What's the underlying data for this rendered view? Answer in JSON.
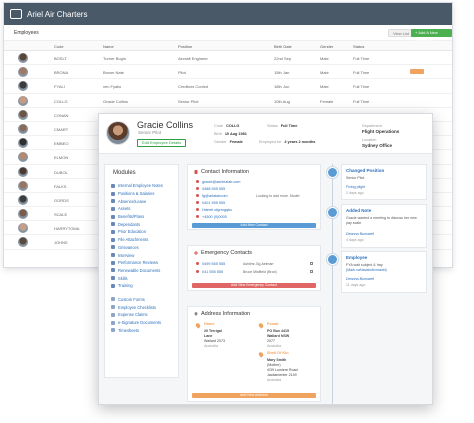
{
  "app": {
    "title": "Ariel Air Charters"
  },
  "employees": {
    "title": "Employees",
    "view_btn": "View List",
    "add_btn": "+ Add A New Employee",
    "columns": [
      "Code",
      "Name",
      "Position",
      "Birth Date",
      "Gender",
      "Status"
    ],
    "rows": [
      {
        "code": "BOSLT",
        "name": "Turner Bogin",
        "position": "Aircraft Engineer",
        "birth": "22nd Sep",
        "gender": "Male",
        "status": "Full Time",
        "badge": false
      },
      {
        "code": "BRONA",
        "name": "Brown Nate",
        "position": "Pilot",
        "birth": "15th Jan",
        "gender": "Male",
        "status": "Full Time",
        "badge": true
      },
      {
        "code": "FYALI",
        "name": "ven Fyalio",
        "position": "Creditors Control",
        "birth": "18th Jun",
        "gender": "Male",
        "status": "Full Time",
        "badge": false
      },
      {
        "code": "COLLG",
        "name": "Gracie Collins",
        "position": "Senior Pilot",
        "birth": "10th Aug",
        "gender": "Female",
        "status": "Full Time",
        "badge": false
      },
      {
        "code": "CONAN",
        "name": "",
        "position": "",
        "birth": "",
        "gender": "",
        "status": "",
        "badge": false
      },
      {
        "code": "CMART",
        "name": "",
        "position": "",
        "birth": "",
        "gender": "",
        "status": "",
        "badge": false
      },
      {
        "code": "EMBEO",
        "name": "",
        "position": "",
        "birth": "",
        "gender": "",
        "status": "",
        "badge": false
      },
      {
        "code": "ELMON",
        "name": "",
        "position": "",
        "birth": "",
        "gender": "",
        "status": "",
        "badge": false
      },
      {
        "code": "DUBOL",
        "name": "",
        "position": "",
        "birth": "",
        "gender": "",
        "status": "",
        "badge": false
      },
      {
        "code": "FALKS",
        "name": "",
        "position": "",
        "birth": "",
        "gender": "",
        "status": "",
        "badge": false
      },
      {
        "code": "GORDS",
        "name": "",
        "position": "",
        "birth": "",
        "gender": "",
        "status": "",
        "badge": false
      },
      {
        "code": "SCALE",
        "name": "",
        "position": "",
        "birth": "",
        "gender": "",
        "status": "",
        "badge": false
      },
      {
        "code": "HARRYTOMA",
        "name": "",
        "position": "",
        "birth": "",
        "gender": "",
        "status": "",
        "badge": false
      },
      {
        "code": "JOHNS",
        "name": "",
        "position": "",
        "birth": "",
        "gender": "",
        "status": "",
        "badge": false
      }
    ]
  },
  "profile": {
    "name": "Gracie Collins",
    "role": "Senior Pilot",
    "edit_btn": "Edit Employee Details",
    "code_label": "Code",
    "code": "COLLG",
    "status_label": "Status",
    "status": "Full Time",
    "birth_label": "Birth",
    "birth": "10 Aug 1981",
    "gender_label": "Gender",
    "gender": "Female",
    "employed_label": "Employed for",
    "employed": "4 years 2 months",
    "dept_label": "Department",
    "dept": "Flight Operations",
    "location_label": "Location",
    "location": "Sydney Office"
  },
  "modules": {
    "title": "Modules",
    "items": [
      "Internal Employee Notes",
      "Positions & Salaries",
      "Absence/Leave",
      "Assets",
      "Benefits/Plans",
      "Dependants",
      "Prior Education",
      "File Attachments",
      "Grievances",
      "Interview",
      "Performance Reviews",
      "Renewable Documents",
      "Skills",
      "Training"
    ],
    "others": [
      "Custom Forms",
      "Employee Checklists",
      "Expense Claims",
      "e-Signature Documents",
      "Timesheets"
    ]
  },
  "contact": {
    "title": "Contact Information",
    "email": "gracie@ashirialair.com",
    "phone1": "0488 555 555",
    "phone1_note": "",
    "work_email": "fg@arialaircom",
    "work_note": "Looking to add more. Model",
    "phone2": "0401 555 555",
    "phone2_note": "",
    "address_line": "Hdemt ofgrmgqbc",
    "extra": "+4500 (0)0000",
    "add_btn": "Add New Contact"
  },
  "emergency": {
    "title": "Emergency Contacts",
    "row1_phone": "0499 555 555",
    "row1_note": "Ashilmr-Gg.Aelmarr",
    "row2_phone": "041 555 555",
    "row2_note": "Bruce Miidfield (Brod)",
    "add_btn": "Add New Emergency Contact"
  },
  "address": {
    "title": "Address Information",
    "home_tag": "Home",
    "home_lines": [
      "20 Terrigal",
      "Lane",
      "Wallard 2073",
      "Australia"
    ],
    "postal_tag": "Postal",
    "postal_lines": [
      "PO Box 4415",
      "Wallard NSW",
      "2077",
      "Australia"
    ],
    "other_tag": "Shell Of Kin",
    "other_lines": [
      "Mary Smith",
      "(Mother)",
      "4/39 Lumiere Road",
      "Jackamenter 2149",
      "Australia"
    ],
    "add_btn": "Add New Address"
  },
  "timeline": [
    {
      "title": "Changed Position",
      "lines": [
        "Senior Pilot",
        "Fixing plight",
        "2 days ago"
      ]
    },
    {
      "title": "Added Note",
      "lines": [
        "Gracie wanted a meeting to discuss her new",
        "pay scale.",
        "Deanna Bunswell",
        "4 days ago"
      ]
    },
    {
      "title": "Employee",
      "lines": [
        "FYA wait subject & fray",
        "(Mark.vaNavabotivmankl)",
        "Deanna Bunswell",
        "11 days ago"
      ]
    }
  ],
  "colors": {
    "accent": "#5b9bd5",
    "header": "#4a5967",
    "orange": "#f0a35e",
    "red": "#e06666",
    "green": "#4caf50"
  }
}
